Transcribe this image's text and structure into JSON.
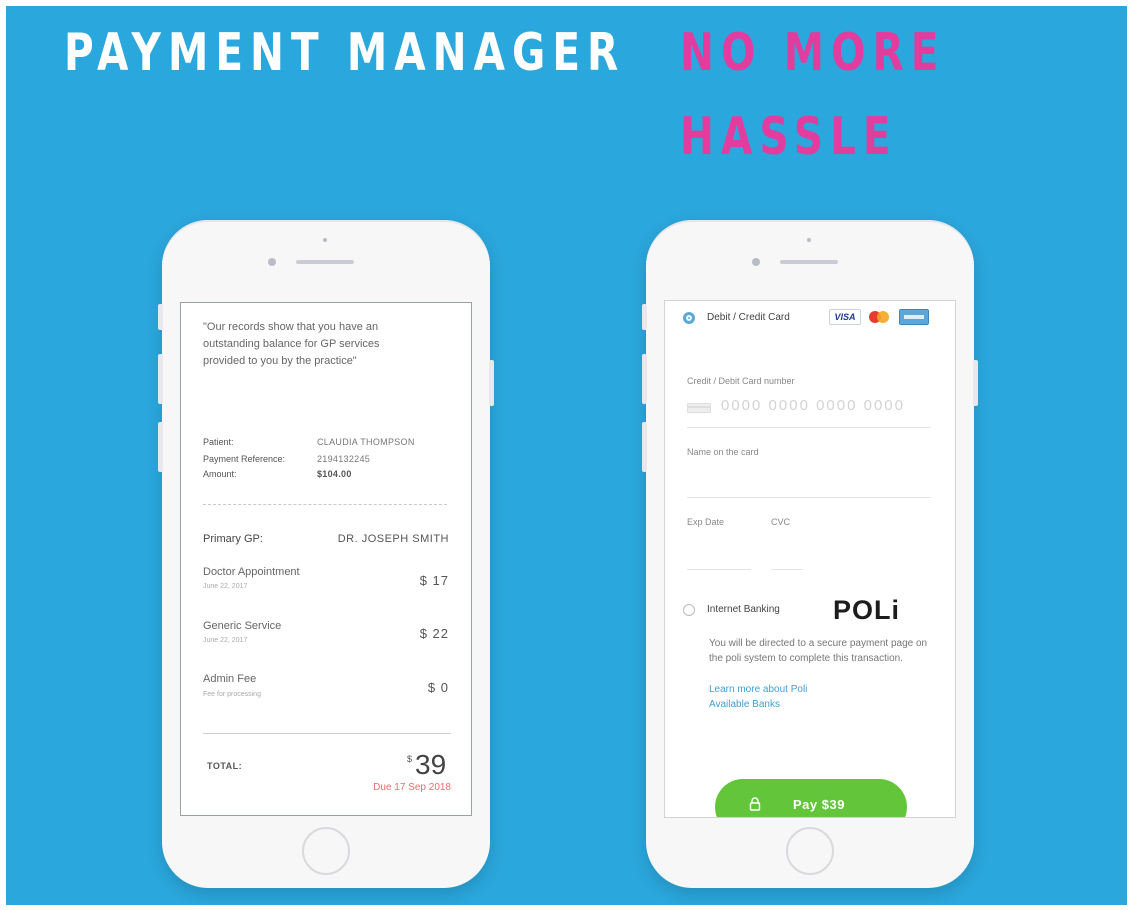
{
  "headline": {
    "title": "PAYMENT MANAGER",
    "tagline_line1": "NO MORE",
    "tagline_line2": "HASSLE"
  },
  "colors": {
    "background": "#2aa7dd",
    "tagline": "#e23c9e",
    "pay_button": "#63c63a",
    "due_text": "#ef6b6b",
    "link": "#3f9fd4"
  },
  "statement": {
    "quote": "\"Our records show that you have an outstanding balance for GP services provided to you by the practice\"",
    "patient_label": "Patient:",
    "patient_value": "CLAUDIA THOMPSON",
    "reference_label": "Payment Reference:",
    "reference_value": "2194132245",
    "amount_label": "Amount:",
    "amount_value": "$104.00",
    "gp_label": "Primary GP:",
    "gp_value": "DR. JOSEPH SMITH",
    "items": [
      {
        "name": "Doctor Appointment",
        "sub": "June 22, 2017",
        "price": "$ 17"
      },
      {
        "name": "Generic Service",
        "sub": "June 22, 2017",
        "price": "$ 22"
      },
      {
        "name": "Admin Fee",
        "sub": "Fee for processing",
        "price": "$ 0"
      }
    ],
    "total_label": "TOTAL:",
    "total_currency": "$",
    "total_value": "39",
    "due": "Due 17 Sep 2018"
  },
  "payment": {
    "card_option": "Debit / Credit Card",
    "card_logos": [
      "VISA",
      "mastercard-icon",
      "amex-icon"
    ],
    "card_number_label": "Credit / Debit Card number",
    "card_number_placeholder": "0000 0000 0000 0000",
    "name_label": "Name on the card",
    "expiry_label": "Exp Date",
    "cvc_label": "CVC",
    "bank_option": "Internet Banking",
    "poli_logo": "POLi",
    "poli_text": "You will be directed to a secure payment page on the poli system to complete this transaction.",
    "learn_more": "Learn more about Poli",
    "available_banks": "Available Banks",
    "pay_button": "Pay $39",
    "selected_option": "Debit / Credit Card"
  }
}
